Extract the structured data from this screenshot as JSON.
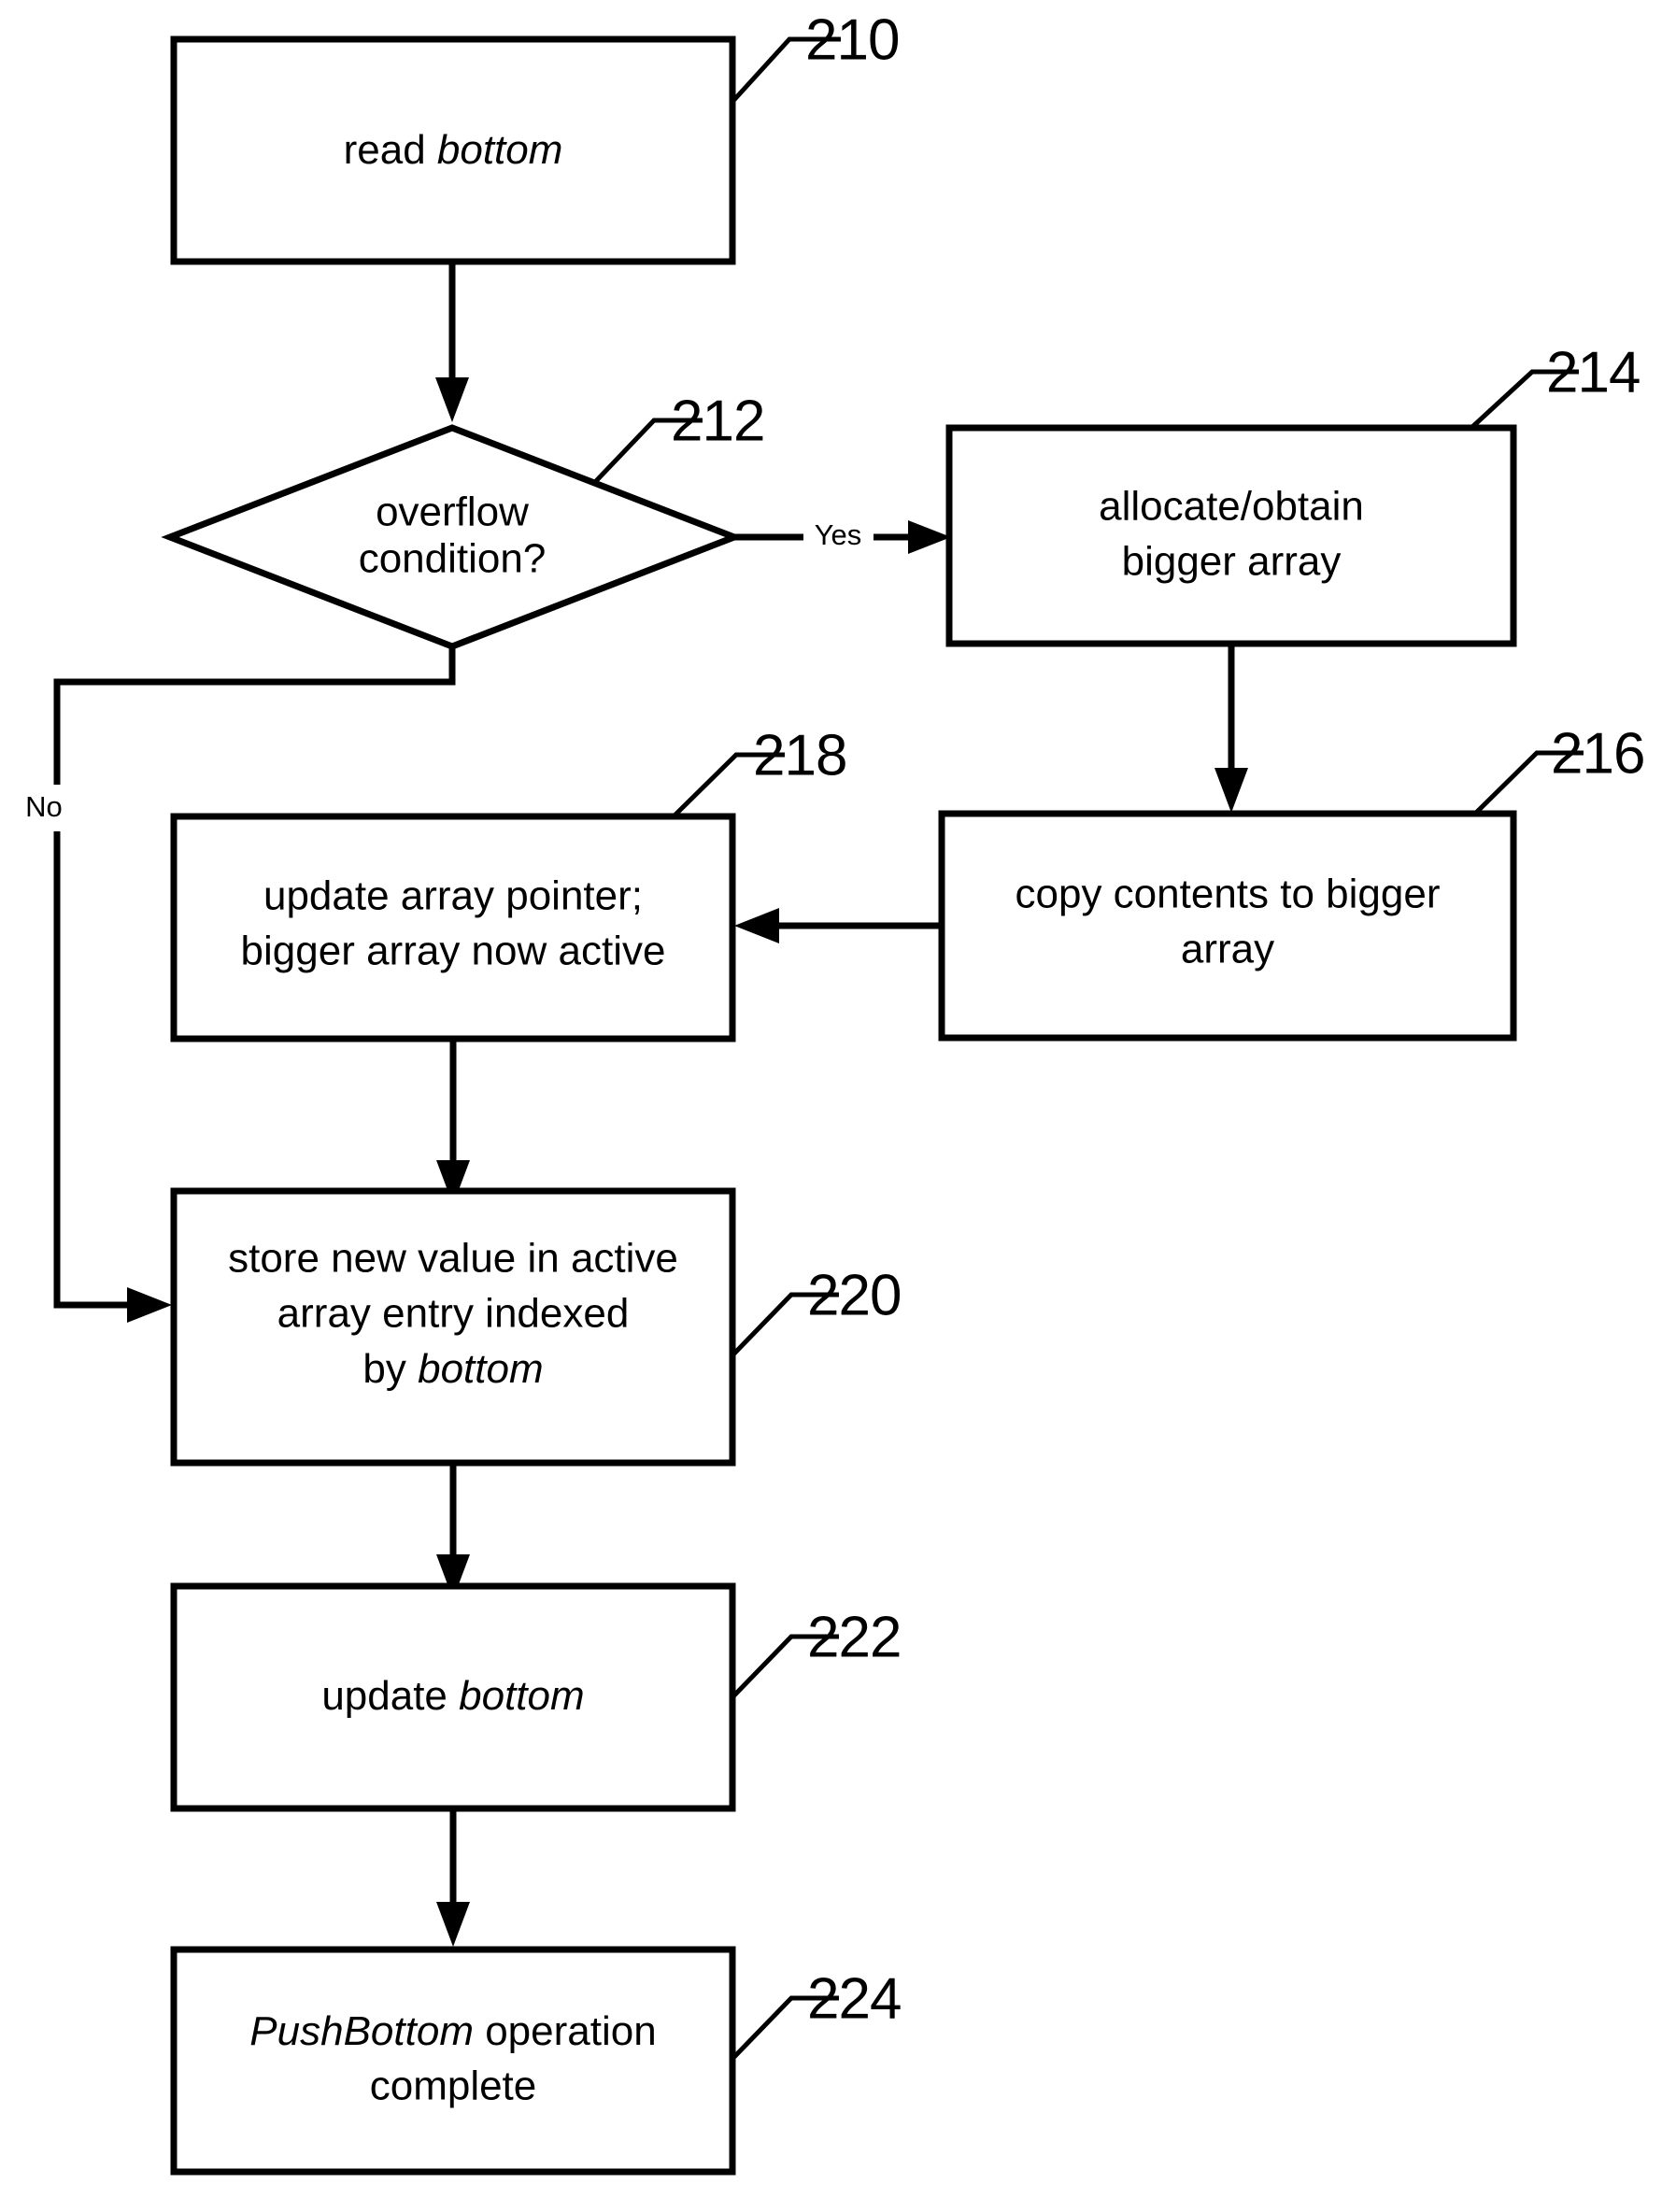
{
  "figure": {
    "type": "flowchart",
    "description": "PushBottom operation flowchart",
    "background_color": "#ffffff",
    "line_color": "#000000"
  },
  "nodes": [
    {
      "id": "n210",
      "ref": "210",
      "shape": "rectangle",
      "lines": [
        {
          "parts": [
            {
              "text": "read ",
              "italic": false
            },
            {
              "text": "bottom",
              "italic": true
            }
          ]
        }
      ]
    },
    {
      "id": "n212",
      "ref": "212",
      "shape": "diamond",
      "lines": [
        {
          "parts": [
            {
              "text": "overflow",
              "italic": false
            }
          ]
        },
        {
          "parts": [
            {
              "text": "condition?",
              "italic": false
            }
          ]
        }
      ]
    },
    {
      "id": "n214",
      "ref": "214",
      "shape": "rectangle",
      "lines": [
        {
          "parts": [
            {
              "text": "allocate/obtain",
              "italic": false
            }
          ]
        },
        {
          "parts": [
            {
              "text": "bigger array",
              "italic": false
            }
          ]
        }
      ]
    },
    {
      "id": "n216",
      "ref": "216",
      "shape": "rectangle",
      "lines": [
        {
          "parts": [
            {
              "text": "copy contents to bigger",
              "italic": false
            }
          ]
        },
        {
          "parts": [
            {
              "text": "array",
              "italic": false
            }
          ]
        }
      ]
    },
    {
      "id": "n218",
      "ref": "218",
      "shape": "rectangle",
      "lines": [
        {
          "parts": [
            {
              "text": "update array pointer;",
              "italic": false
            }
          ]
        },
        {
          "parts": [
            {
              "text": "bigger array now active",
              "italic": false
            }
          ]
        }
      ]
    },
    {
      "id": "n220",
      "ref": "220",
      "shape": "rectangle",
      "lines": [
        {
          "parts": [
            {
              "text": "store new value in active",
              "italic": false
            }
          ]
        },
        {
          "parts": [
            {
              "text": "array entry indexed",
              "italic": false
            }
          ]
        },
        {
          "parts": [
            {
              "text": "by  ",
              "italic": false
            },
            {
              "text": "bottom",
              "italic": true
            }
          ]
        }
      ]
    },
    {
      "id": "n222",
      "ref": "222",
      "shape": "rectangle",
      "lines": [
        {
          "parts": [
            {
              "text": "update ",
              "italic": false
            },
            {
              "text": "bottom",
              "italic": true
            }
          ]
        }
      ]
    },
    {
      "id": "n224",
      "ref": "224",
      "shape": "rectangle",
      "lines": [
        {
          "parts": [
            {
              "text": "PushBottom",
              "italic": true
            },
            {
              "text": " operation",
              "italic": false
            }
          ]
        },
        {
          "parts": [
            {
              "text": "complete",
              "italic": false
            }
          ]
        }
      ]
    }
  ],
  "reference_labels": {
    "n210": "210",
    "n212": "212",
    "n214": "214",
    "n216": "216",
    "n218": "218",
    "n220": "220",
    "n222": "222",
    "n224": "224"
  },
  "node_text": {
    "n210_l0_a": "read ",
    "n210_l0_b": "bottom",
    "n212_l0": "overflow",
    "n212_l1": "condition?",
    "n214_l0": "allocate/obtain",
    "n214_l1": "bigger array",
    "n216_l0": "copy contents to bigger",
    "n216_l1": "array",
    "n218_l0": "update array pointer;",
    "n218_l1": "bigger array now active",
    "n220_l0": "store new value in active",
    "n220_l1": "array entry indexed",
    "n220_l2_a": "by  ",
    "n220_l2_b": "bottom",
    "n222_l0_a": "update ",
    "n222_l0_b": "bottom",
    "n224_l0_a": "PushBottom",
    "n224_l0_b": " operation",
    "n224_l1": "complete"
  },
  "edge_labels": {
    "yes": "Yes",
    "no": "No"
  },
  "edges": [
    {
      "from": "n210",
      "to": "n212",
      "label": ""
    },
    {
      "from": "n212",
      "to": "n214",
      "label": "Yes"
    },
    {
      "from": "n212",
      "to": "n220",
      "label": "No"
    },
    {
      "from": "n214",
      "to": "n216",
      "label": ""
    },
    {
      "from": "n216",
      "to": "n218",
      "label": ""
    },
    {
      "from": "n218",
      "to": "n220",
      "label": ""
    },
    {
      "from": "n220",
      "to": "n222",
      "label": ""
    },
    {
      "from": "n222",
      "to": "n224",
      "label": ""
    }
  ]
}
